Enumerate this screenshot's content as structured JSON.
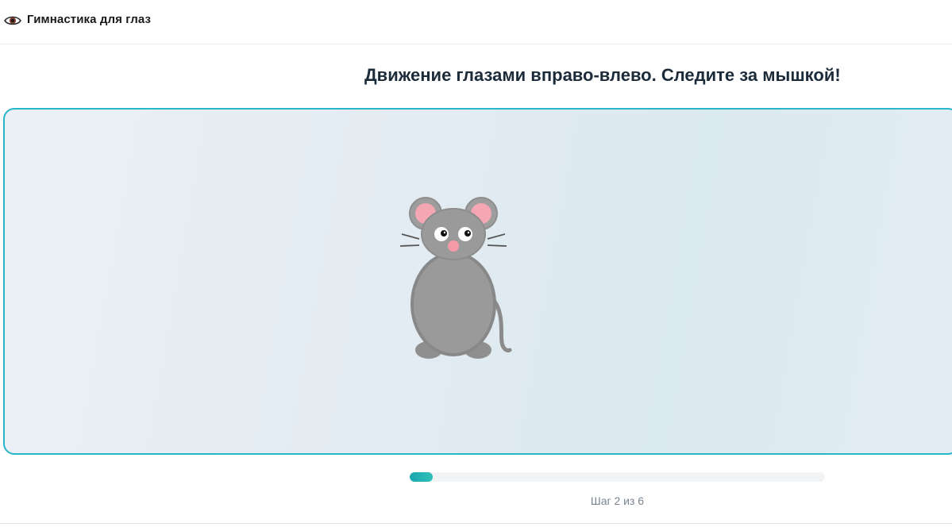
{
  "header": {
    "title": "Гимнастика для глаз",
    "icon": "eye-icon"
  },
  "instruction": "Движение глазами вправо-влево. Следите за мышкой!",
  "stage": {
    "character": "mouse",
    "border_color": "#29b6c9"
  },
  "progress": {
    "current_step": 2,
    "total_steps": 6,
    "fraction": 0.055,
    "label": "Шаг 2 из 6",
    "fill_color": "#1aa7b0"
  }
}
